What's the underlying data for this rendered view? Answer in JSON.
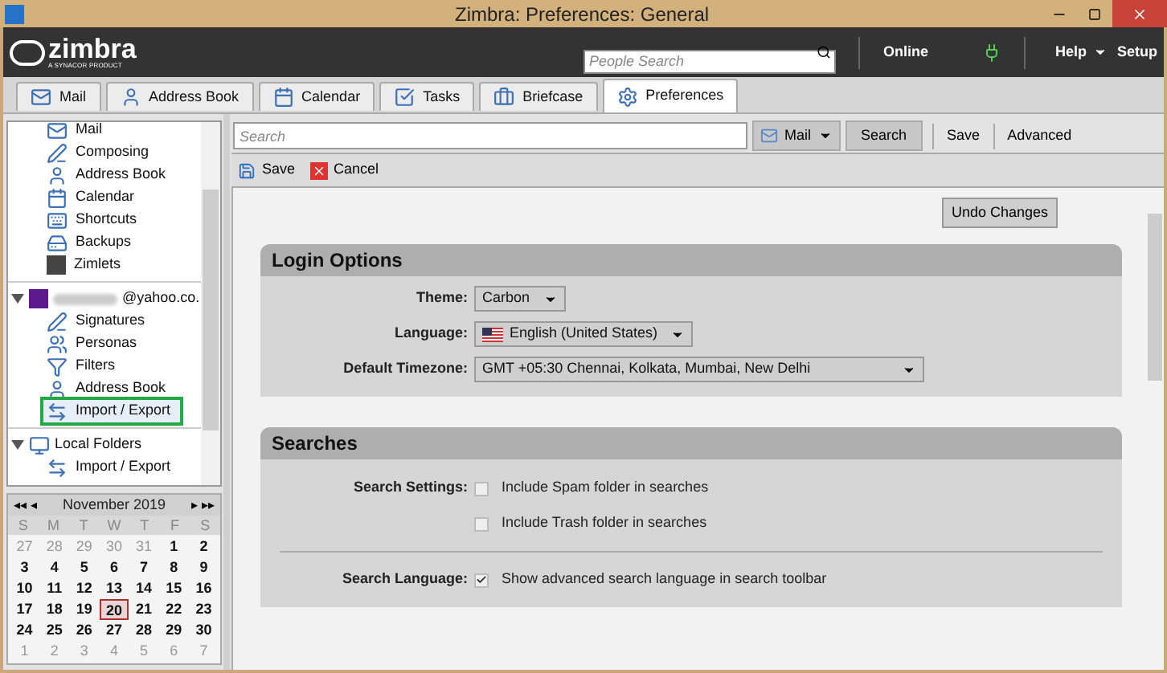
{
  "window": {
    "title": "Zimbra: Preferences: General"
  },
  "header": {
    "logo": "zimbra",
    "logo_tagline": "A SYNACOR PRODUCT",
    "people_search": {
      "placeholder": "People Search"
    },
    "status": "Online",
    "help": "Help",
    "setup": "Setup"
  },
  "tabs": [
    {
      "label": "Mail",
      "selected": false
    },
    {
      "label": "Address Book",
      "selected": false
    },
    {
      "label": "Calendar",
      "selected": false
    },
    {
      "label": "Tasks",
      "selected": false
    },
    {
      "label": "Briefcase",
      "selected": false
    },
    {
      "label": "Preferences",
      "selected": true
    }
  ],
  "sidebar": {
    "groups": [
      {
        "children": [
          {
            "label": "Mail",
            "selected": false
          },
          {
            "label": "Composing",
            "selected": false
          },
          {
            "label": "Address Book",
            "selected": false
          },
          {
            "label": "Calendar",
            "selected": false
          },
          {
            "label": "Shortcuts",
            "selected": false
          },
          {
            "label": "Backups",
            "selected": false
          },
          {
            "label": "Zimlets",
            "selected": false
          }
        ]
      },
      {
        "label": "@yahoo.co.",
        "expanded": true,
        "children": [
          {
            "label": "Signatures",
            "selected": false
          },
          {
            "label": "Personas",
            "selected": false
          },
          {
            "label": "Filters",
            "selected": false
          },
          {
            "label": "Address Book",
            "selected": false
          },
          {
            "label": "Import / Export",
            "selected": true
          }
        ]
      },
      {
        "label": "Local Folders",
        "expanded": true,
        "children": [
          {
            "label": "Import / Export",
            "selected": false
          }
        ]
      }
    ]
  },
  "mini_calendar": {
    "nav_first": "◂◂",
    "nav_prev": "◂",
    "month": "November 2019",
    "nav_next": "▸",
    "nav_last": "▸▸",
    "weekdays": [
      "S",
      "M",
      "T",
      "W",
      "T",
      "F",
      "S"
    ],
    "weeks": [
      [
        {
          "day": "27",
          "other_month": true,
          "selected": false
        },
        {
          "day": "28",
          "other_month": true,
          "selected": false
        },
        {
          "day": "29",
          "other_month": true,
          "selected": false
        },
        {
          "day": "30",
          "other_month": true,
          "selected": false
        },
        {
          "day": "31",
          "other_month": true,
          "selected": false
        },
        {
          "day": "1",
          "other_month": false,
          "selected": false
        },
        {
          "day": "2",
          "other_month": false,
          "selected": false
        }
      ],
      [
        {
          "day": "3",
          "other_month": false,
          "selected": false
        },
        {
          "day": "4",
          "other_month": false,
          "selected": false
        },
        {
          "day": "5",
          "other_month": false,
          "selected": false
        },
        {
          "day": "6",
          "other_month": false,
          "selected": false
        },
        {
          "day": "7",
          "other_month": false,
          "selected": false
        },
        {
          "day": "8",
          "other_month": false,
          "selected": false
        },
        {
          "day": "9",
          "other_month": false,
          "selected": false
        }
      ],
      [
        {
          "day": "10",
          "other_month": false,
          "selected": false
        },
        {
          "day": "11",
          "other_month": false,
          "selected": false
        },
        {
          "day": "12",
          "other_month": false,
          "selected": false
        },
        {
          "day": "13",
          "other_month": false,
          "selected": false
        },
        {
          "day": "14",
          "other_month": false,
          "selected": false
        },
        {
          "day": "15",
          "other_month": false,
          "selected": false
        },
        {
          "day": "16",
          "other_month": false,
          "selected": false
        }
      ],
      [
        {
          "day": "17",
          "other_month": false,
          "selected": false
        },
        {
          "day": "18",
          "other_month": false,
          "selected": false
        },
        {
          "day": "19",
          "other_month": false,
          "selected": false
        },
        {
          "day": "20",
          "other_month": false,
          "selected": true
        },
        {
          "day": "21",
          "other_month": false,
          "selected": false
        },
        {
          "day": "22",
          "other_month": false,
          "selected": false
        },
        {
          "day": "23",
          "other_month": false,
          "selected": false
        }
      ],
      [
        {
          "day": "24",
          "other_month": false,
          "selected": false
        },
        {
          "day": "25",
          "other_month": false,
          "selected": false
        },
        {
          "day": "26",
          "other_month": false,
          "selected": false
        },
        {
          "day": "27",
          "other_month": false,
          "selected": false
        },
        {
          "day": "28",
          "other_month": false,
          "selected": false
        },
        {
          "day": "29",
          "other_month": false,
          "selected": false
        },
        {
          "day": "30",
          "other_month": false,
          "selected": false
        }
      ],
      [
        {
          "day": "1",
          "other_month": true,
          "selected": false
        },
        {
          "day": "2",
          "other_month": true,
          "selected": false
        },
        {
          "day": "3",
          "other_month": true,
          "selected": false
        },
        {
          "day": "4",
          "other_month": true,
          "selected": false
        },
        {
          "day": "5",
          "other_month": true,
          "selected": false
        },
        {
          "day": "6",
          "other_month": true,
          "selected": false
        },
        {
          "day": "7",
          "other_month": true,
          "selected": false
        }
      ]
    ]
  },
  "search_bar": {
    "placeholder": "Search",
    "scope": "Mail",
    "search": "Search",
    "save": "Save",
    "advanced": "Advanced"
  },
  "actions": {
    "save": "Save",
    "cancel": "Cancel"
  },
  "undo_button": "Undo Changes",
  "sections": [
    {
      "title": "Login Options",
      "rows": [
        {
          "label": "Theme:",
          "kind": "select",
          "value": "Carbon"
        },
        {
          "label": "Language:",
          "kind": "flag_select",
          "value": "English (United States)"
        },
        {
          "label": "Default Timezone:",
          "kind": "wide_select",
          "value": "GMT +05:30 Chennai, Kolkata, Mumbai, New Delhi"
        }
      ]
    },
    {
      "title": "Searches",
      "rows": [
        {
          "label": "Search Settings:",
          "kind": "checkbox",
          "value": "Include Spam folder in searches",
          "checked": false
        },
        {
          "kind": "checkbox",
          "value": "Include Trash folder in searches",
          "checked": false
        },
        {
          "kind": "divider"
        },
        {
          "label": "Search Language:",
          "kind": "checkbox",
          "value": "Show advanced search language in search toolbar",
          "checked": true
        }
      ]
    }
  ]
}
